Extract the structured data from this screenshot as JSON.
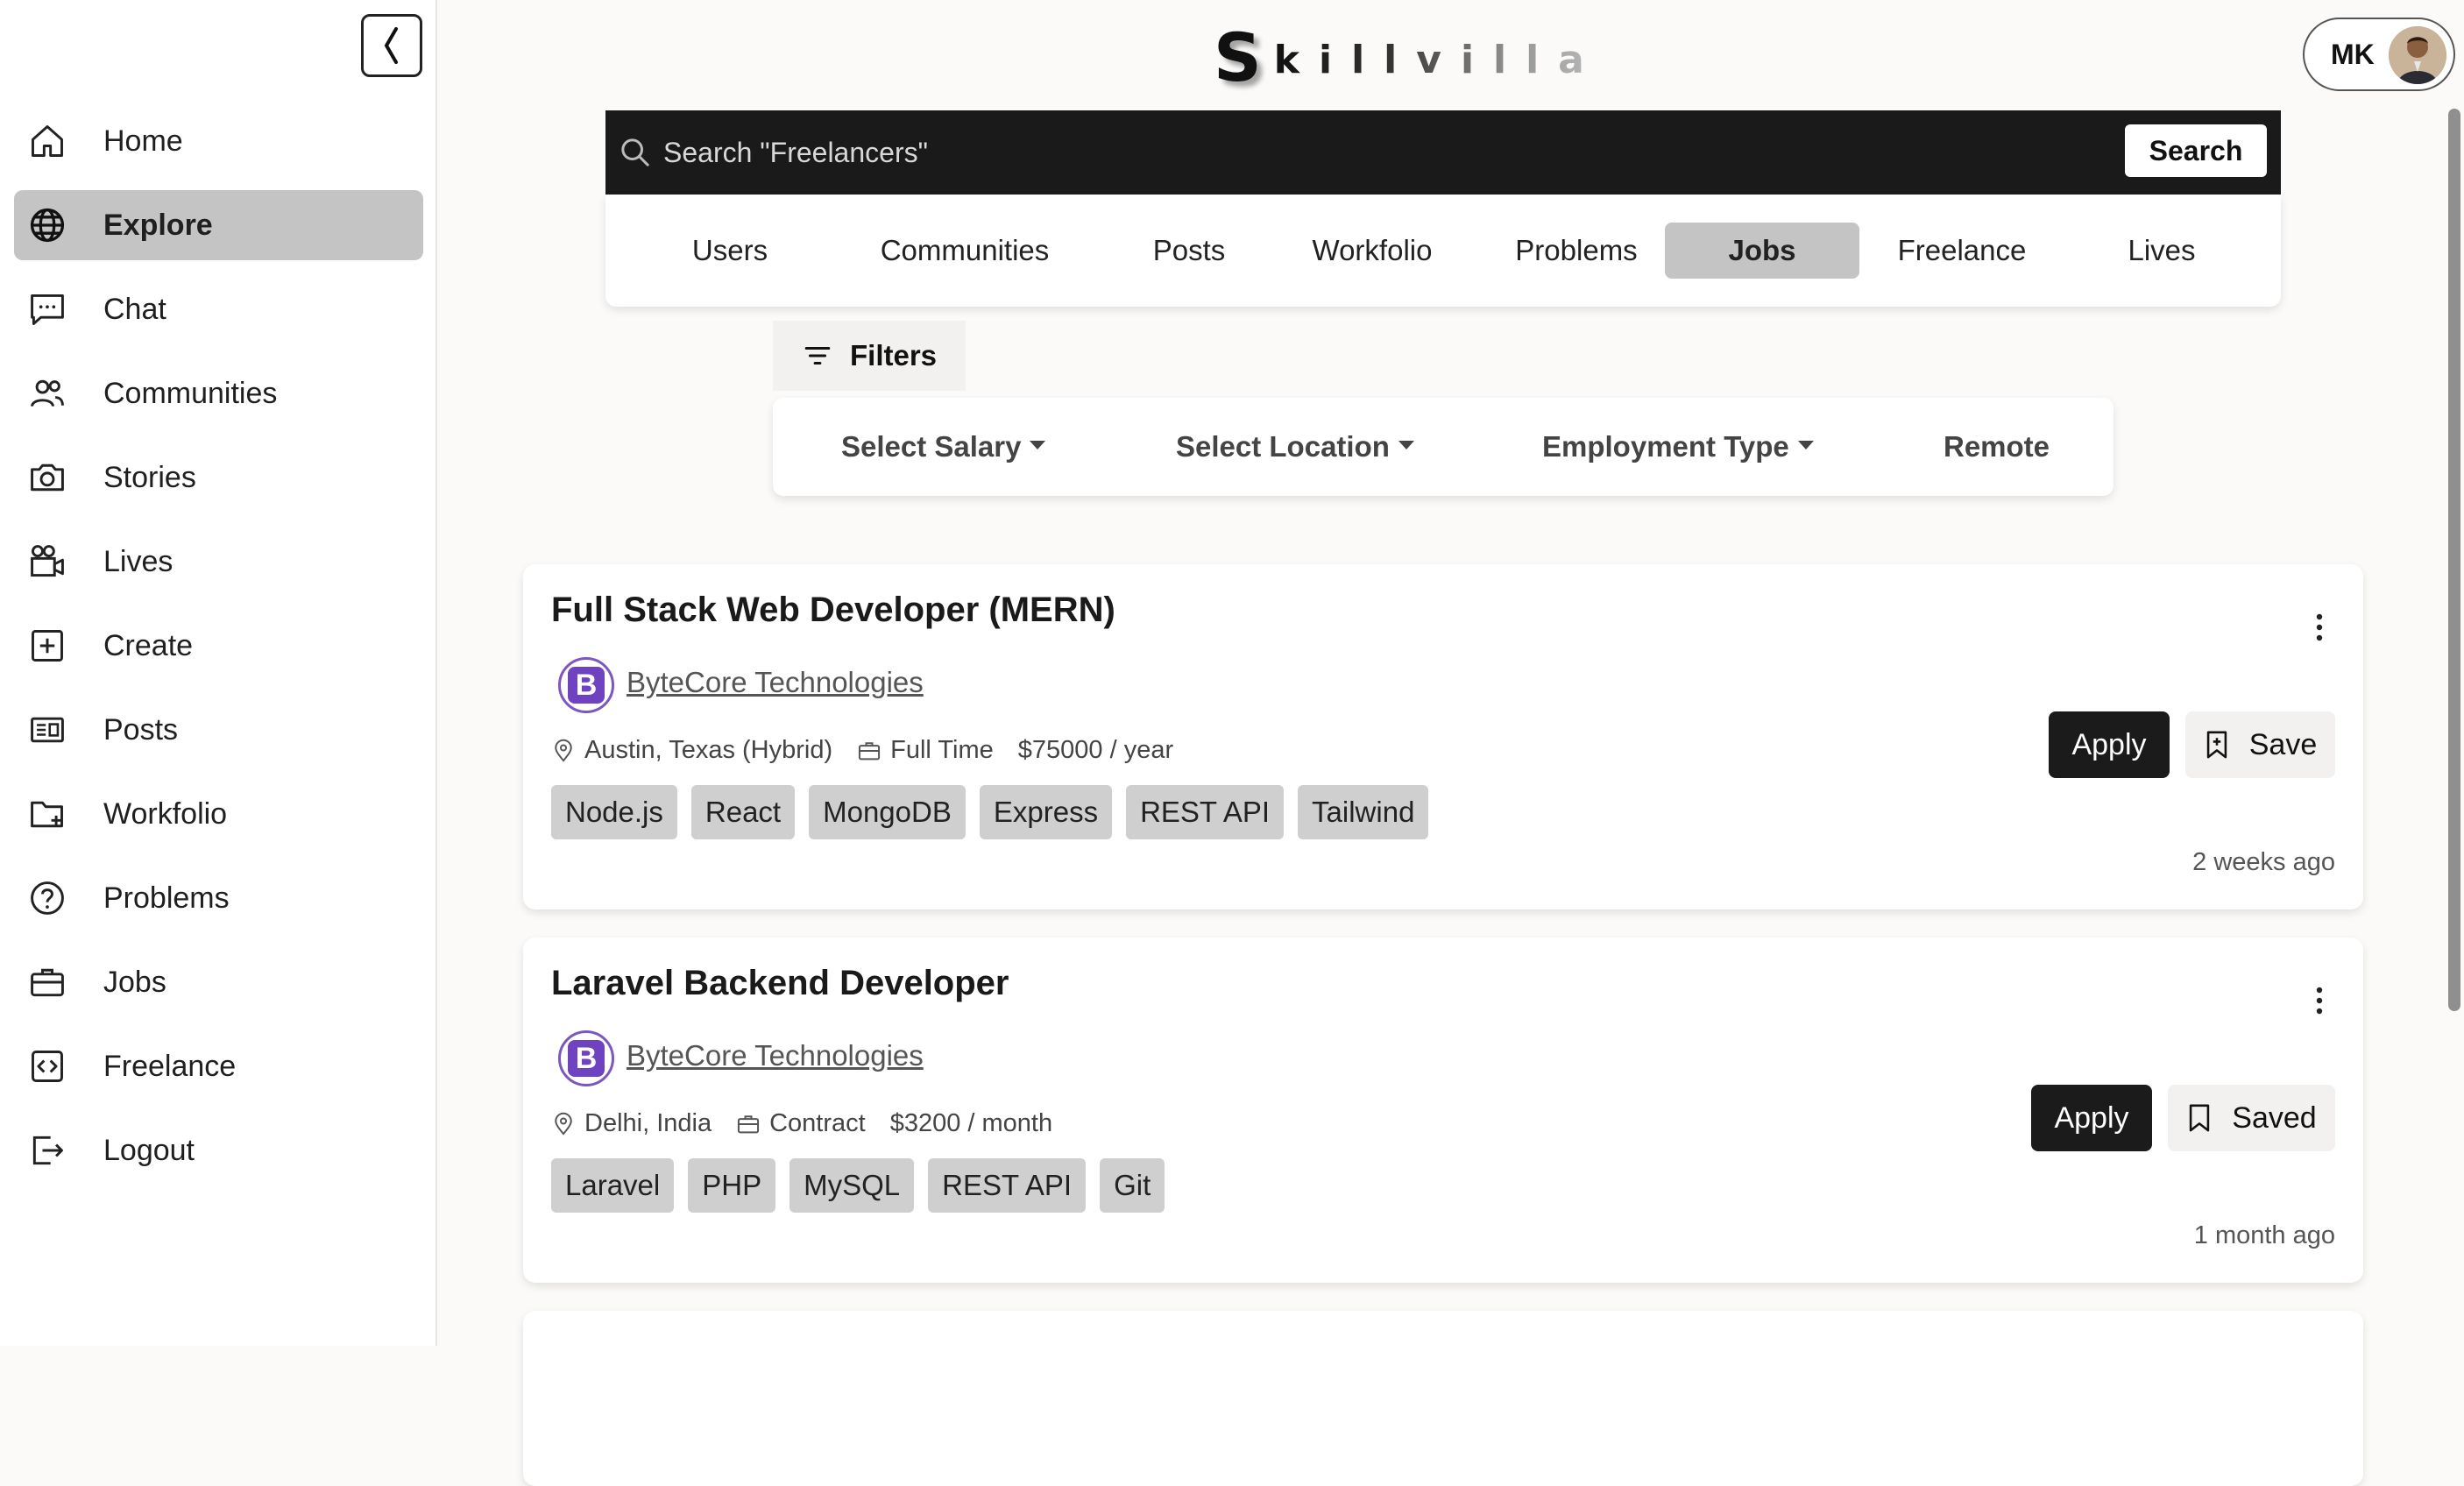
{
  "brand": {
    "logo_first": "S",
    "logo_rest": "killvilla"
  },
  "profile": {
    "initials": "MK"
  },
  "sidebar": {
    "items": [
      {
        "label": "Home",
        "icon": "home-icon"
      },
      {
        "label": "Explore",
        "icon": "globe-icon",
        "active": true
      },
      {
        "label": "Chat",
        "icon": "chat-icon"
      },
      {
        "label": "Communities",
        "icon": "people-icon"
      },
      {
        "label": "Stories",
        "icon": "camera-icon"
      },
      {
        "label": "Lives",
        "icon": "video-icon"
      },
      {
        "label": "Create",
        "icon": "plus-square-icon"
      },
      {
        "label": "Posts",
        "icon": "newspaper-icon"
      },
      {
        "label": "Workfolio",
        "icon": "folder-plus-icon"
      },
      {
        "label": "Problems",
        "icon": "question-icon"
      },
      {
        "label": "Jobs",
        "icon": "briefcase-icon"
      },
      {
        "label": "Freelance",
        "icon": "code-icon"
      },
      {
        "label": "Logout",
        "icon": "logout-icon"
      }
    ]
  },
  "search": {
    "placeholder": "Search \"Freelancers\"",
    "button_label": "Search"
  },
  "tabs": [
    "Users",
    "Communities",
    "Posts",
    "Workfolio",
    "Problems",
    "Jobs",
    "Freelance",
    "Lives"
  ],
  "active_tab": "Jobs",
  "filters": {
    "button_label": "Filters",
    "options": [
      "Select Salary",
      "Select Location",
      "Employment Type",
      "Remote"
    ]
  },
  "jobs": [
    {
      "title": "Full Stack Web Developer (MERN)",
      "company": "ByteCore Technologies",
      "company_initial": "B",
      "location": "Austin, Texas (Hybrid)",
      "employment_type": "Full Time",
      "salary": "$75000 / year",
      "skills": [
        "Node.js",
        "React",
        "MongoDB",
        "Express",
        "REST API",
        "Tailwind"
      ],
      "apply_label": "Apply",
      "save_label": "Save",
      "posted": "2 weeks ago"
    },
    {
      "title": "Laravel Backend Developer",
      "company": "ByteCore Technologies",
      "company_initial": "B",
      "location": "Delhi, India",
      "employment_type": "Contract",
      "salary": "$3200 / month",
      "skills": [
        "Laravel",
        "PHP",
        "MySQL",
        "REST API",
        "Git"
      ],
      "apply_label": "Apply",
      "save_label": "Saved",
      "posted": "1 month ago"
    }
  ],
  "colors": {
    "accent_dark": "#1b1b1b",
    "active_bg": "#c4c4c4",
    "company_brand": "#6f42c1"
  }
}
